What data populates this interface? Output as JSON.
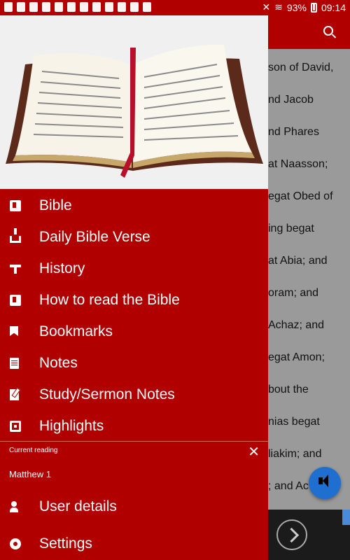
{
  "status_bar": {
    "battery": "93%",
    "time": "09:14"
  },
  "background": {
    "lines": [
      "son of David,",
      "nd Jacob",
      "nd Phares",
      "at Naasson;",
      "egat Obed of",
      "ing begat",
      "at Abia; and",
      "oram; and",
      "Achaz; and",
      "egat Amon;",
      "bout the",
      "nias begat",
      "liakim; and",
      "; and Ac"
    ]
  },
  "drawer": {
    "menu": [
      {
        "label": "Bible"
      },
      {
        "label": "Daily Bible Verse"
      },
      {
        "label": "History"
      },
      {
        "label": "How to read the Bible"
      },
      {
        "label": "Bookmarks"
      },
      {
        "label": "Notes"
      },
      {
        "label": "Study/Sermon Notes"
      },
      {
        "label": "Highlights"
      }
    ],
    "current_reading_label": "Current reading",
    "current_reading_value": "Matthew 1",
    "close_symbol": "✕",
    "footer": [
      {
        "label": "User details"
      },
      {
        "label": "Settings"
      }
    ]
  },
  "colors": {
    "primary": "#b00000",
    "fab": "#1f6fd0"
  }
}
